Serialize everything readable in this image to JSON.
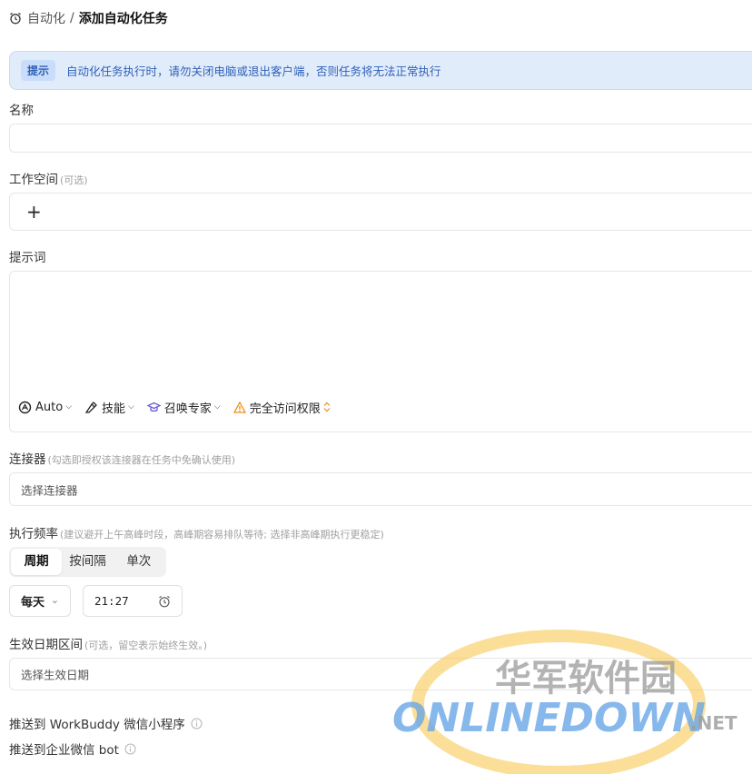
{
  "breadcrumb": {
    "parent": "自动化",
    "separator": "/",
    "title": "添加自动化任务"
  },
  "alert": {
    "tag": "提示",
    "message": "自动化任务执行时，请勿关闭电脑或退出客户端，否则任务将无法正常执行"
  },
  "name_field": {
    "label": "名称",
    "value": ""
  },
  "workspace": {
    "label": "工作空间",
    "hint": "(可选)",
    "add_symbol": "+"
  },
  "prompt": {
    "label": "提示词",
    "value": "",
    "toolbar": {
      "model": "Auto",
      "skills": "技能",
      "expert": "召唤专家",
      "access": "完全访问权限"
    }
  },
  "connector": {
    "label": "连接器",
    "hint": "(勾选即授权该连接器在任务中免确认使用)",
    "placeholder": "选择连接器"
  },
  "frequency": {
    "label": "执行频率",
    "hint": "(建议避开上午高峰时段，高峰期容易排队等待; 选择非高峰期执行更稳定)",
    "options": [
      "周期",
      "按间隔",
      "单次"
    ],
    "selected": "周期",
    "day": "每天",
    "time": "21:27"
  },
  "date_range": {
    "label": "生效日期区间",
    "hint": "(可选，留空表示始终生效。)",
    "placeholder": "选择生效日期"
  },
  "push_workbuddy": "推送到 WorkBuddy 微信小程序",
  "push_wecom": "推送到企业微信 bot",
  "watermark": {
    "cn": "华军软件园",
    "en": "ONLINEDOWN",
    "suffix": ".NET"
  },
  "colors": {
    "alert_bg": "#e1ecfb",
    "alert_text": "#2f5fb8",
    "warning": "#f08c1a",
    "expert_icon": "#6b5fd6"
  }
}
